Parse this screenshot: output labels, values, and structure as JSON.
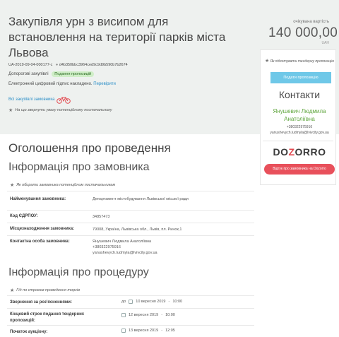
{
  "tender": {
    "title": "Закупівля урн з висипом для встановлення на території парків міста Львова",
    "id": "UA-2019-09-04-000177-c",
    "hash": "d4b350bbc3964ced9c9d9b590b7b2674",
    "procurement_type": "Допорогові закупівлі",
    "status_badge": "Подання пропозицій",
    "signature_text": "Електронний цифровий підпис накладено.",
    "verify_link": "Перевірити",
    "all_purchases_link": "Всі закупівлі замовника",
    "attention_note": "На що звернути увагу потенційному постачальнику"
  },
  "price": {
    "label": "очікувана вартість",
    "value": "140 000,00",
    "currency": "UAH"
  },
  "sidebar": {
    "prep_note": "Як підготувати тендерну пропозицію",
    "submit_button": "Подати пропозицію",
    "contacts_title": "Контакти",
    "contact_name": "Янушевич Людмила Анатоліївна",
    "contact_phone": "+380322975916",
    "contact_email": "yanushevych.ludmyla@lvivcity.gov.ua",
    "dozorro_part1": "DO",
    "dozorro_part2": "Z",
    "dozorro_part3": "ORRO",
    "dozorro_button": "Відгук про замовника на Dozorro"
  },
  "announcement": {
    "title": "Оголошення про проведення",
    "customer_title": "Інформація про замовника",
    "customer_note": "Як обирати замовника потенційним постачальникам",
    "rows": [
      {
        "label": "Найменування замовника:",
        "value": "Департамент містобудування Львівської міської ради"
      },
      {
        "label": "Код ЄДРПОУ:",
        "value": "34857473"
      },
      {
        "label": "Місцезнаходження замовника:",
        "value": "79008, Україна, Львівська обл., Львів, пл. Ринок,1"
      },
      {
        "label": "Контактна особа замовника:",
        "value_name": "Янушевич Людмила Анатоліївна",
        "value_phone": "+380322975916",
        "value_email": "yanushevych.ludmyla@lvivcity.gov.ua"
      }
    ]
  },
  "procedure": {
    "title": "Інформація про процедуру",
    "note": "Гід по строкам проведення торгів",
    "rows": [
      {
        "label": "Звернення за роз'ясненнями:",
        "prefix": "до",
        "date": "10 вересня 2019",
        "time": "10:00"
      },
      {
        "label": "Кінцевий строк подання тендерних пропозицій:",
        "prefix": "",
        "date": "12 вересня 2019",
        "time": "10:00"
      },
      {
        "label": "Початок аукціону:",
        "prefix": "",
        "date": "13 вересня 2019",
        "time": "12:05"
      }
    ]
  }
}
